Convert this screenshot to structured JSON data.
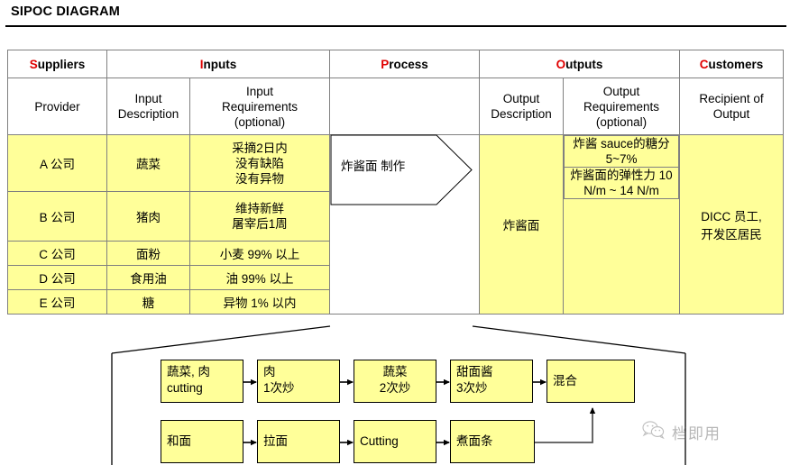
{
  "title": "SIPOC DIAGRAM",
  "accent_color": "#e00000",
  "fill_color": "#ffff99",
  "table": {
    "headers": [
      {
        "cap": "S",
        "rest": "uppliers"
      },
      {
        "cap": "I",
        "rest": "nputs"
      },
      {
        "cap": "P",
        "rest": "rocess"
      },
      {
        "cap": "O",
        "rest": "utputs"
      },
      {
        "cap": "C",
        "rest": "ustomers"
      }
    ],
    "subheaders": {
      "supplier": "Provider",
      "input_description": "Input\nDescription",
      "input_requirements": "Input\nRequirements\n(optional)",
      "process": "",
      "output_description": "Output\nDescription",
      "output_requirements": "Output\nRequirements\n(optional)",
      "customer": "Recipient of\nOutput"
    },
    "rows": [
      {
        "supplier": "A 公司",
        "input_description": "蔬菜",
        "input_requirements": "采摘2日内\n没有缺陷\n没有异物"
      },
      {
        "supplier": "B 公司",
        "input_description": "猪肉",
        "input_requirements": "维持新鲜\n屠宰后1周"
      },
      {
        "supplier": "C 公司",
        "input_description": "面粉",
        "input_requirements": "小麦 99% 以上"
      },
      {
        "supplier": "D 公司",
        "input_description": "食用油",
        "input_requirements": "油 99% 以上"
      },
      {
        "supplier": "E 公司",
        "input_description": "糖",
        "input_requirements": "异物 1% 以内"
      }
    ],
    "process_step": "炸酱面 制作",
    "output_description": "炸酱面",
    "output_requirements": [
      "炸酱 sauce的糖分 5~7%",
      "炸酱面的弹性力 10 N/m ~ 14 N/m"
    ],
    "customer": "DICC 员工,\n开发区居民"
  },
  "flowchart": {
    "row1": [
      {
        "line1": "蔬菜, 肉",
        "line2": "cutting"
      },
      {
        "line1": "肉",
        "line2": "1次炒"
      },
      {
        "line1": "蔬菜",
        "line2": "2次炒"
      },
      {
        "line1": "甜面酱",
        "line2": "3次炒"
      },
      {
        "line1": "混合",
        "line2": ""
      }
    ],
    "row2": [
      {
        "line1": "和面",
        "line2": ""
      },
      {
        "line1": "拉面",
        "line2": ""
      },
      {
        "line1": "Cutting",
        "line2": ""
      },
      {
        "line1": "煮面条",
        "line2": ""
      }
    ]
  },
  "watermark": {
    "text": "档即用",
    "icon": "wechat-icon"
  }
}
